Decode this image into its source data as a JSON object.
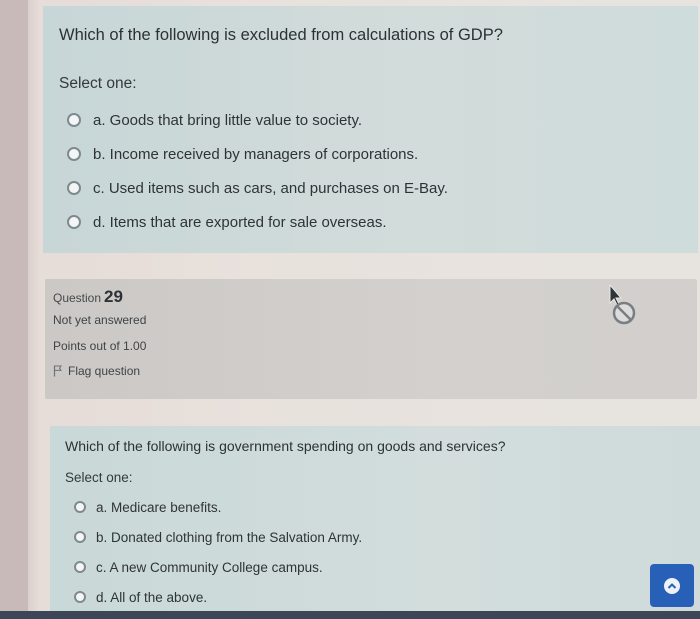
{
  "question_prev": {
    "text": "Which of the following is excluded from calculations of GDP?",
    "prompt": "Select one:",
    "answers": [
      {
        "label": "a. Goods that bring little value to society."
      },
      {
        "label": "b. Income received by managers of corporations."
      },
      {
        "label": "c. Used items such as cars, and purchases on E-Bay."
      },
      {
        "label": "d. Items that are exported for sale overseas."
      }
    ]
  },
  "question_info": {
    "question_word": "Question",
    "number": "29",
    "state": "Not yet answered",
    "grade": "Points out of 1.00",
    "flag_label": "Flag question"
  },
  "question_current": {
    "text": "Which of the following is government spending on goods and services?",
    "prompt": "Select one:",
    "answers": [
      {
        "label": "a. Medicare benefits."
      },
      {
        "label": "b. Donated clothing from the Salvation Army."
      },
      {
        "label": "c. A new Community College campus."
      },
      {
        "label": "d. All of the above."
      }
    ]
  },
  "colors": {
    "content_bg": "#cad8d8",
    "info_bg": "#cfccc9",
    "accent_button": "#2860b8"
  },
  "icons": {
    "flag": "flag-icon",
    "cursor": "not-allowed-cursor-icon",
    "scroll_top": "chevron-up-icon"
  }
}
